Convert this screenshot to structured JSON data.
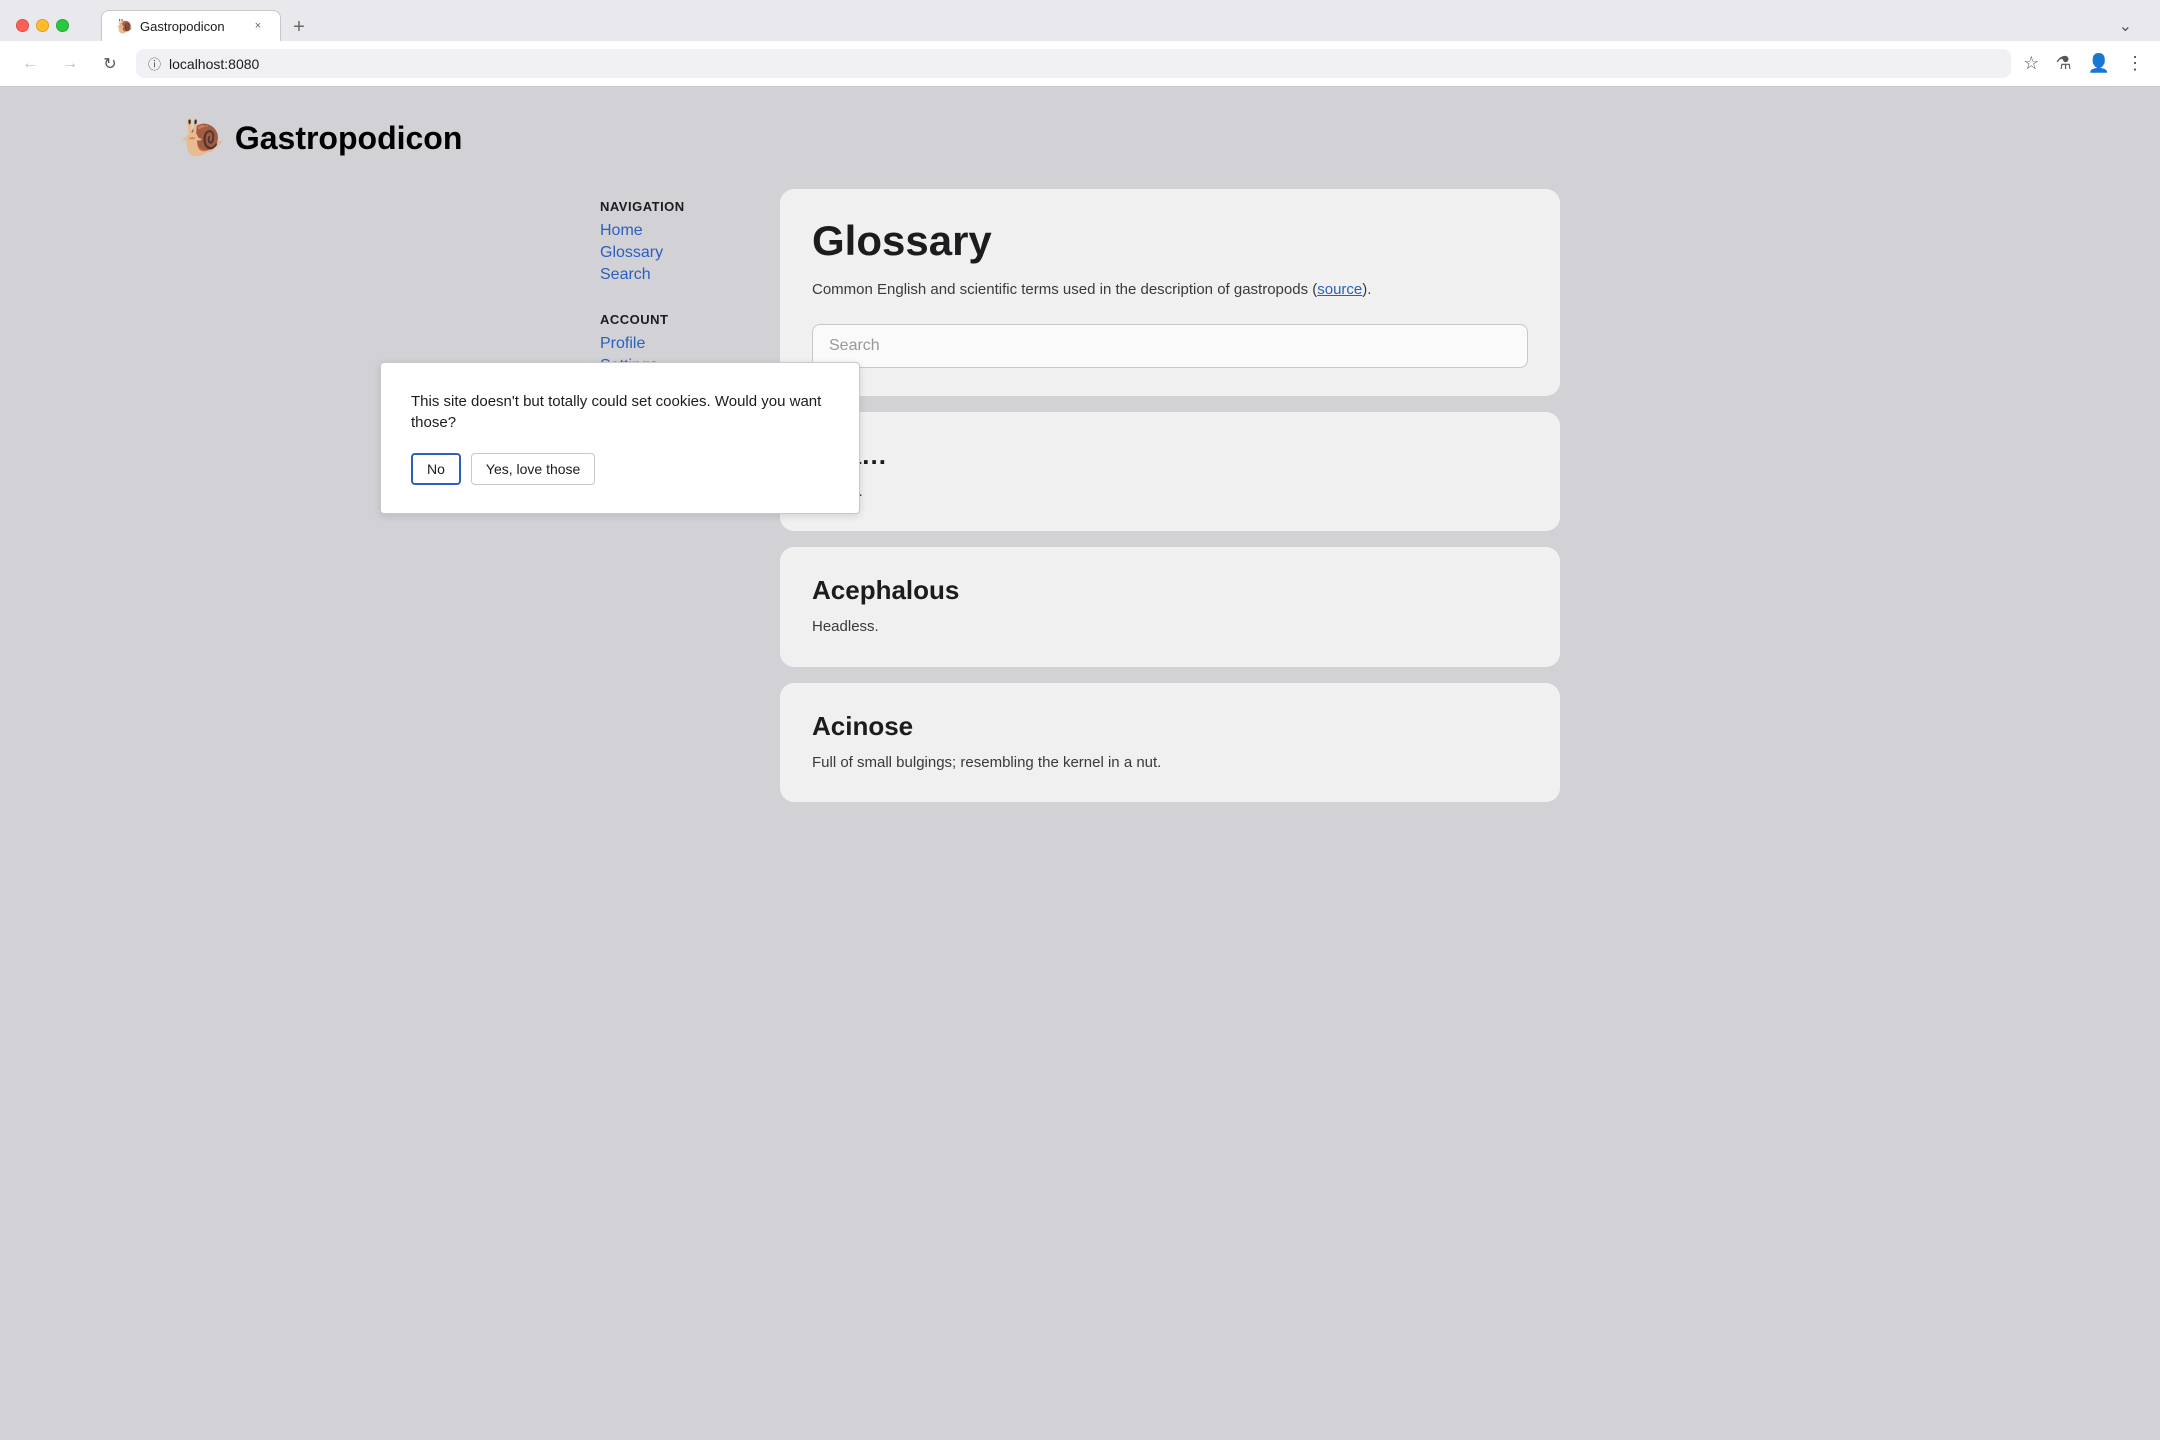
{
  "browser": {
    "tab_favicon": "🐌",
    "tab_title": "Gastropodicon",
    "tab_close": "×",
    "tab_new": "+",
    "tab_dropdown": "⌄",
    "nav_back": "←",
    "nav_forward": "→",
    "nav_reload": "↻",
    "address_bar_url": "localhost:8080",
    "lock_icon": "ⓘ",
    "bookmark_icon": "☆",
    "labs_icon": "⚗",
    "profile_icon": "👤",
    "menu_icon": "⋮"
  },
  "site": {
    "snail_emoji": "🐌",
    "site_title": "Gastropodicon"
  },
  "sidebar": {
    "navigation_label": "NAVIGATION",
    "nav_items": [
      {
        "label": "Home",
        "href": "#"
      },
      {
        "label": "Glossary",
        "href": "#"
      },
      {
        "label": "Search",
        "href": "#"
      }
    ],
    "account_label": "ACCOUNT",
    "account_items": [
      {
        "label": "Profile",
        "href": "#"
      },
      {
        "label": "Settings",
        "href": "#"
      }
    ]
  },
  "main": {
    "page_title": "Glossary",
    "page_description": "Common English and scientific terms used in the description of gastropods (",
    "source_link_text": "source",
    "page_description_end": ").",
    "search_placeholder": "Search",
    "terms": [
      {
        "title": "Aba…",
        "description": "Away…"
      },
      {
        "title": "Acephalous",
        "description": "Headless."
      },
      {
        "title": "Acinose",
        "description": "Full of small bulgings; resembling the kernel in a nut."
      }
    ]
  },
  "cookie_dialog": {
    "message": "This site doesn't but totally could set cookies. Would you want those?",
    "btn_no_label": "No",
    "btn_yes_label": "Yes, love those"
  }
}
